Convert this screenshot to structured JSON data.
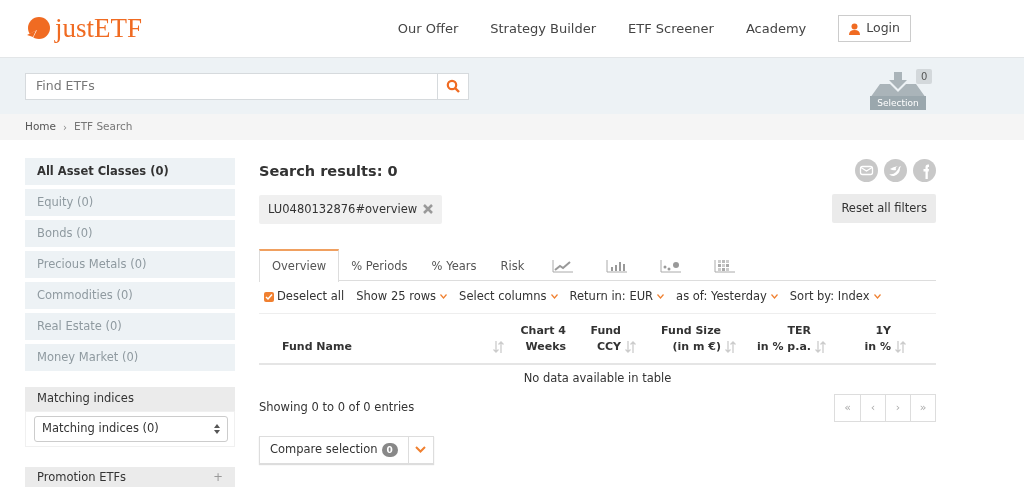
{
  "header": {
    "logo": "justETF",
    "nav": [
      "Our Offer",
      "Strategy Builder",
      "ETF Screener",
      "Academy"
    ],
    "login": "Login"
  },
  "search": {
    "placeholder": "Find ETFs",
    "selection_label": "Selection",
    "selection_count": "0"
  },
  "breadcrumb": {
    "separator": "›",
    "items": [
      "Home",
      "ETF Search"
    ]
  },
  "sidebar": {
    "asset_classes": [
      {
        "label": "All Asset Classes (0)",
        "selected": true,
        "disabled": false
      },
      {
        "label": "Equity (0)",
        "selected": false,
        "disabled": true
      },
      {
        "label": "Bonds (0)",
        "selected": false,
        "disabled": true
      },
      {
        "label": "Precious Metals (0)",
        "selected": false,
        "disabled": true
      },
      {
        "label": "Commodities (0)",
        "selected": false,
        "disabled": true
      },
      {
        "label": "Real Estate (0)",
        "selected": false,
        "disabled": true
      },
      {
        "label": "Money Market (0)",
        "selected": false,
        "disabled": true
      }
    ],
    "matching_indices": {
      "title": "Matching indices",
      "value": "Matching indices (0)"
    },
    "promotion": {
      "title": "Promotion ETFs",
      "toggle": "+"
    }
  },
  "results": {
    "title": "Search results: 0",
    "filter_tag": "LU0480132876#overview",
    "reset": "Reset all filters",
    "tabs": [
      {
        "kind": "text",
        "label": "Overview",
        "selected": true
      },
      {
        "kind": "text",
        "label": "% Periods",
        "selected": false
      },
      {
        "kind": "text",
        "label": "% Years",
        "selected": false
      },
      {
        "kind": "text",
        "label": "Risk",
        "selected": false
      },
      {
        "kind": "icon",
        "selected": false
      },
      {
        "kind": "icon",
        "selected": false
      },
      {
        "kind": "icon",
        "selected": false
      },
      {
        "kind": "icon",
        "selected": false
      }
    ],
    "toolbar": {
      "select_all": {
        "label": "Deselect all",
        "checked": true
      },
      "dropdowns": [
        "Show 25 rows",
        "Select columns",
        "Return in: EUR",
        "as of: Yesterday",
        "Sort by: Index"
      ]
    },
    "table": {
      "columns": [
        {
          "label": "Fund Name",
          "sortable": true
        },
        {
          "label": "Chart 4\nWeeks",
          "sortable": false
        },
        {
          "label": "Fund\nCCY",
          "sortable": true
        },
        {
          "label": "Fund Size\n(in m €)",
          "sortable": true
        },
        {
          "label": "TER\nin % p.a.",
          "sortable": true
        },
        {
          "label": "1Y\nin %",
          "sortable": true
        }
      ],
      "empty": "No data available in table"
    },
    "info": "Showing 0 to 0 of 0 entries",
    "pagination": [
      "«",
      "‹",
      "›",
      "»"
    ],
    "compare": {
      "label": "Compare selection",
      "count": "0"
    }
  }
}
